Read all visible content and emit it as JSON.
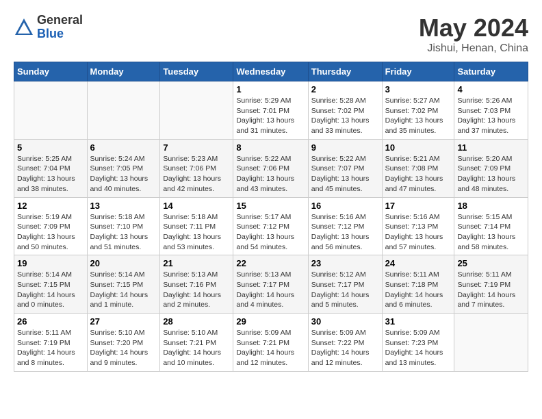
{
  "logo": {
    "general": "General",
    "blue": "Blue"
  },
  "title": "May 2024",
  "subtitle": "Jishui, Henan, China",
  "days_of_week": [
    "Sunday",
    "Monday",
    "Tuesday",
    "Wednesday",
    "Thursday",
    "Friday",
    "Saturday"
  ],
  "weeks": [
    [
      {
        "day": "",
        "info": ""
      },
      {
        "day": "",
        "info": ""
      },
      {
        "day": "",
        "info": ""
      },
      {
        "day": "1",
        "info": "Sunrise: 5:29 AM\nSunset: 7:01 PM\nDaylight: 13 hours\nand 31 minutes."
      },
      {
        "day": "2",
        "info": "Sunrise: 5:28 AM\nSunset: 7:02 PM\nDaylight: 13 hours\nand 33 minutes."
      },
      {
        "day": "3",
        "info": "Sunrise: 5:27 AM\nSunset: 7:02 PM\nDaylight: 13 hours\nand 35 minutes."
      },
      {
        "day": "4",
        "info": "Sunrise: 5:26 AM\nSunset: 7:03 PM\nDaylight: 13 hours\nand 37 minutes."
      }
    ],
    [
      {
        "day": "5",
        "info": "Sunrise: 5:25 AM\nSunset: 7:04 PM\nDaylight: 13 hours\nand 38 minutes."
      },
      {
        "day": "6",
        "info": "Sunrise: 5:24 AM\nSunset: 7:05 PM\nDaylight: 13 hours\nand 40 minutes."
      },
      {
        "day": "7",
        "info": "Sunrise: 5:23 AM\nSunset: 7:06 PM\nDaylight: 13 hours\nand 42 minutes."
      },
      {
        "day": "8",
        "info": "Sunrise: 5:22 AM\nSunset: 7:06 PM\nDaylight: 13 hours\nand 43 minutes."
      },
      {
        "day": "9",
        "info": "Sunrise: 5:22 AM\nSunset: 7:07 PM\nDaylight: 13 hours\nand 45 minutes."
      },
      {
        "day": "10",
        "info": "Sunrise: 5:21 AM\nSunset: 7:08 PM\nDaylight: 13 hours\nand 47 minutes."
      },
      {
        "day": "11",
        "info": "Sunrise: 5:20 AM\nSunset: 7:09 PM\nDaylight: 13 hours\nand 48 minutes."
      }
    ],
    [
      {
        "day": "12",
        "info": "Sunrise: 5:19 AM\nSunset: 7:09 PM\nDaylight: 13 hours\nand 50 minutes."
      },
      {
        "day": "13",
        "info": "Sunrise: 5:18 AM\nSunset: 7:10 PM\nDaylight: 13 hours\nand 51 minutes."
      },
      {
        "day": "14",
        "info": "Sunrise: 5:18 AM\nSunset: 7:11 PM\nDaylight: 13 hours\nand 53 minutes."
      },
      {
        "day": "15",
        "info": "Sunrise: 5:17 AM\nSunset: 7:12 PM\nDaylight: 13 hours\nand 54 minutes."
      },
      {
        "day": "16",
        "info": "Sunrise: 5:16 AM\nSunset: 7:12 PM\nDaylight: 13 hours\nand 56 minutes."
      },
      {
        "day": "17",
        "info": "Sunrise: 5:16 AM\nSunset: 7:13 PM\nDaylight: 13 hours\nand 57 minutes."
      },
      {
        "day": "18",
        "info": "Sunrise: 5:15 AM\nSunset: 7:14 PM\nDaylight: 13 hours\nand 58 minutes."
      }
    ],
    [
      {
        "day": "19",
        "info": "Sunrise: 5:14 AM\nSunset: 7:15 PM\nDaylight: 14 hours\nand 0 minutes."
      },
      {
        "day": "20",
        "info": "Sunrise: 5:14 AM\nSunset: 7:15 PM\nDaylight: 14 hours\nand 1 minute."
      },
      {
        "day": "21",
        "info": "Sunrise: 5:13 AM\nSunset: 7:16 PM\nDaylight: 14 hours\nand 2 minutes."
      },
      {
        "day": "22",
        "info": "Sunrise: 5:13 AM\nSunset: 7:17 PM\nDaylight: 14 hours\nand 4 minutes."
      },
      {
        "day": "23",
        "info": "Sunrise: 5:12 AM\nSunset: 7:17 PM\nDaylight: 14 hours\nand 5 minutes."
      },
      {
        "day": "24",
        "info": "Sunrise: 5:11 AM\nSunset: 7:18 PM\nDaylight: 14 hours\nand 6 minutes."
      },
      {
        "day": "25",
        "info": "Sunrise: 5:11 AM\nSunset: 7:19 PM\nDaylight: 14 hours\nand 7 minutes."
      }
    ],
    [
      {
        "day": "26",
        "info": "Sunrise: 5:11 AM\nSunset: 7:19 PM\nDaylight: 14 hours\nand 8 minutes."
      },
      {
        "day": "27",
        "info": "Sunrise: 5:10 AM\nSunset: 7:20 PM\nDaylight: 14 hours\nand 9 minutes."
      },
      {
        "day": "28",
        "info": "Sunrise: 5:10 AM\nSunset: 7:21 PM\nDaylight: 14 hours\nand 10 minutes."
      },
      {
        "day": "29",
        "info": "Sunrise: 5:09 AM\nSunset: 7:21 PM\nDaylight: 14 hours\nand 12 minutes."
      },
      {
        "day": "30",
        "info": "Sunrise: 5:09 AM\nSunset: 7:22 PM\nDaylight: 14 hours\nand 12 minutes."
      },
      {
        "day": "31",
        "info": "Sunrise: 5:09 AM\nSunset: 7:23 PM\nDaylight: 14 hours\nand 13 minutes."
      },
      {
        "day": "",
        "info": ""
      }
    ]
  ]
}
